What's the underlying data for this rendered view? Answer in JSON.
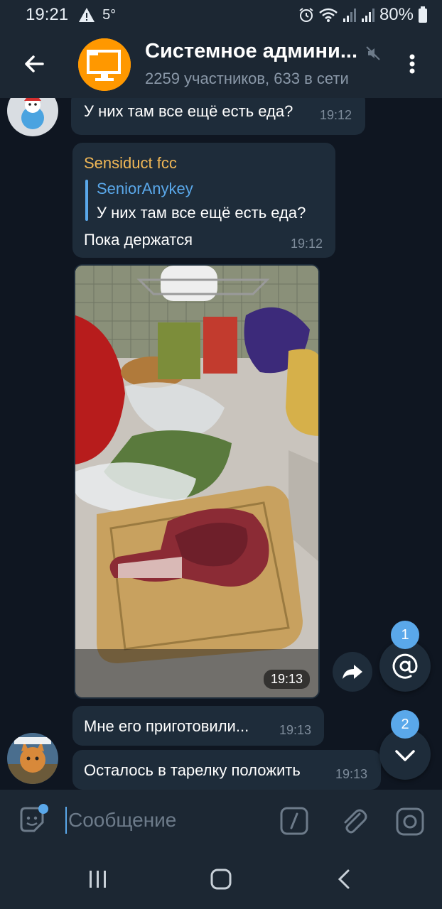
{
  "status_bar": {
    "time": "19:21",
    "temperature": "5°",
    "battery": "80%",
    "icons": [
      "warning-icon",
      "alarm-icon",
      "wifi-icon",
      "signal-icon",
      "signal-icon",
      "battery-icon"
    ]
  },
  "header": {
    "title": "Системное админи...",
    "subtitle": "2259 участников, 633 в сети",
    "avatar_color": "#ff9800"
  },
  "messages": [
    {
      "id": "m1",
      "text": "У них там все ещё есть еда?",
      "time": "19:12"
    },
    {
      "id": "m2",
      "sender": "Sensiduct fcc",
      "reply_to": {
        "name": "SeniorAnykey",
        "text": "У них там все ещё есть еда?"
      },
      "text": "Пока держатся",
      "time": "19:12"
    },
    {
      "id": "m3",
      "type": "photo",
      "time": "19:13"
    },
    {
      "id": "m4",
      "text": "Мне его приготовили...",
      "time": "19:13"
    },
    {
      "id": "m5",
      "text": "Осталось в тарелку положить",
      "time": "19:13"
    }
  ],
  "fabs": {
    "mentions_count": "1",
    "scroll_down_count": "2"
  },
  "composer": {
    "placeholder": "Сообщение"
  },
  "colors": {
    "background": "#0f1621",
    "bar": "#1c2733",
    "bubble": "#1e2c3a",
    "accent": "#5aa8ea",
    "sender": "#f0b756"
  }
}
